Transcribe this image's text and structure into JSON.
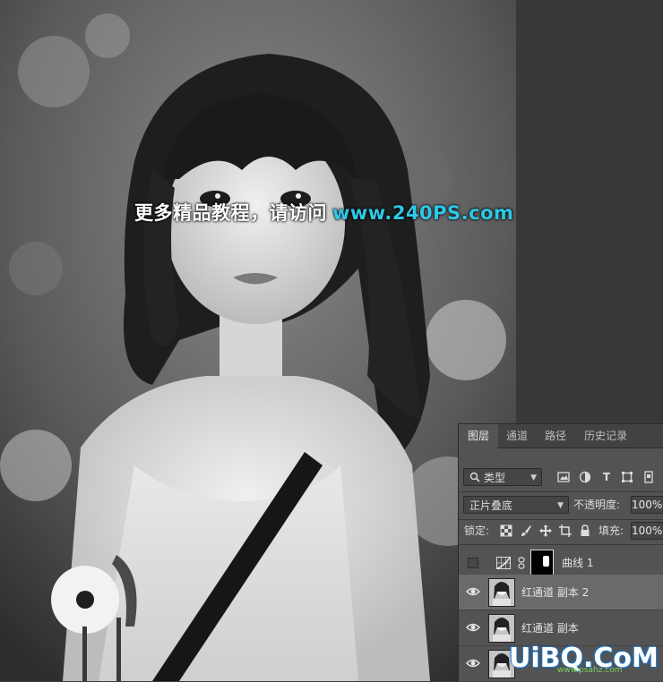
{
  "watermark": {
    "text_cn": "更多精品教程，请访问",
    "url": "www.240PS.com"
  },
  "layers_panel": {
    "tabs": [
      {
        "label": "图层",
        "active": true
      },
      {
        "label": "通道",
        "active": false
      },
      {
        "label": "路径",
        "active": false
      },
      {
        "label": "历史记录",
        "active": false
      }
    ],
    "filter": {
      "label": "类型",
      "icon": "search-icon"
    },
    "blend_mode": "正片叠底",
    "opacity_label": "不透明度:",
    "opacity_value": "100%",
    "lock_label": "锁定:",
    "fill_label": "填充:",
    "fill_value": "100%",
    "layers": [
      {
        "name": "曲线 1",
        "visible": false,
        "selected": false,
        "type": "adjustment-curves"
      },
      {
        "name": "红通道 副本 2",
        "visible": true,
        "selected": true,
        "type": "image"
      },
      {
        "name": "红通道 副本",
        "visible": true,
        "selected": false,
        "type": "image"
      },
      {
        "name": "",
        "visible": true,
        "selected": false,
        "type": "image"
      }
    ]
  },
  "logo": {
    "text": "UiBQ.CoM",
    "subtext": "www.psahz.com"
  },
  "colors": {
    "panel_bg": "#535353",
    "tab_bar": "#424242",
    "selected_layer": "#6a6a6a",
    "watermark_url": "#2ec8e8"
  }
}
